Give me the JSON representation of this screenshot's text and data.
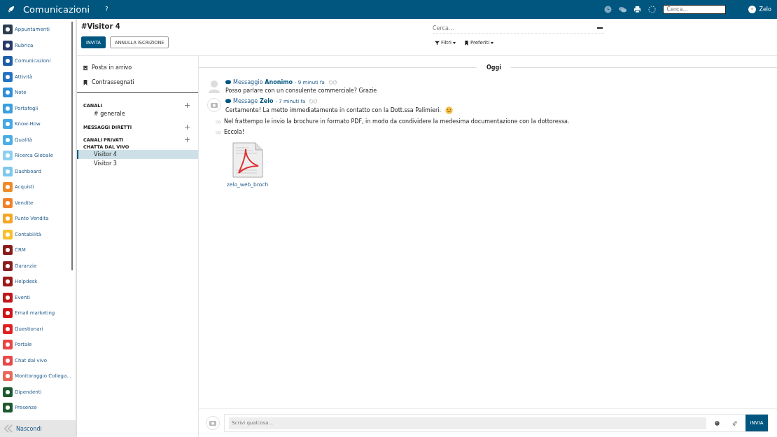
{
  "topbar": {
    "title": "Comunicazioni",
    "help": "?",
    "search": {
      "placeholder": "Cerca..."
    },
    "user": "Zelo"
  },
  "sidebar": {
    "items": [
      {
        "label": "Appuntamenti",
        "color": "#2c3e50"
      },
      {
        "label": "Rubrica",
        "color": "#2a3a6a"
      },
      {
        "label": "Comunicazioni",
        "color": "#1f5fa8"
      },
      {
        "label": "Attività",
        "color": "#2473c4"
      },
      {
        "label": "Note",
        "color": "#2f8fd8"
      },
      {
        "label": "Portafogli",
        "color": "#3ba0e0"
      },
      {
        "label": "Know-How",
        "color": "#45a8e4"
      },
      {
        "label": "Qualità",
        "color": "#4aaee6"
      },
      {
        "label": "Ricerca Globale",
        "color": "#8fd0f0"
      },
      {
        "label": "Dashboard",
        "color": "#7ec8ee"
      },
      {
        "label": "Acquisti",
        "color": "#f08a2a"
      },
      {
        "label": "Vendite",
        "color": "#f0832a"
      },
      {
        "label": "Punto Vendita",
        "color": "#f5a623"
      },
      {
        "label": "Contabilità",
        "color": "#f8c030"
      },
      {
        "label": "CRM",
        "color": "#8b1a1a"
      },
      {
        "label": "Garanzie",
        "color": "#8b1f1f"
      },
      {
        "label": "Helpdesk",
        "color": "#9b1b1b"
      },
      {
        "label": "Eventi",
        "color": "#c0181b"
      },
      {
        "label": "Email marketing",
        "color": "#d0151a"
      },
      {
        "label": "Questionari",
        "color": "#e02020"
      },
      {
        "label": "Portale",
        "color": "#e84545"
      },
      {
        "label": "Chat dal vivo",
        "color": "#e84848"
      },
      {
        "label": "Monitoraggio Collega...",
        "color": "#e86a5a"
      },
      {
        "label": "Dipendenti",
        "color": "#1e5a2e"
      },
      {
        "label": "Presenze",
        "color": "#1e5a30"
      }
    ],
    "hide": "Nascondi"
  },
  "header": {
    "title": "#Visitor 4",
    "buttons": [
      {
        "label": "INVITA",
        "kind": "primary"
      },
      {
        "label": "ANNULLA ISCRIZIONE",
        "kind": "secondary"
      }
    ],
    "search": {
      "placeholder": "Cerca..."
    },
    "filters": [
      {
        "label": "Filtri",
        "kind": "filter"
      },
      {
        "label": "Preferiti",
        "kind": "bookmark"
      }
    ]
  },
  "mailboxes": [
    {
      "label": "Posta in arrivo",
      "kind": "inbox"
    },
    {
      "label": "Contrassegnati",
      "kind": "bookmark"
    }
  ],
  "channel_groups": [
    {
      "title": "CANALI",
      "addable": true,
      "items": [
        {
          "label": "# generale",
          "selected": false
        }
      ]
    },
    {
      "title": "MESSAGGI DIRETTI",
      "addable": true
    },
    {
      "title": "CANALI PRIVATI",
      "addable": true
    },
    {
      "title": "CHATTA DAL VIVO",
      "addable": false,
      "items": [
        {
          "label": "Visitor 4",
          "selected": true
        },
        {
          "label": "Visitor 3",
          "selected": false
        }
      ]
    }
  ],
  "chat": {
    "date": "Oggi",
    "messages": [
      {
        "kind": "visitor",
        "type": "Messaggio",
        "author": "Anonimo",
        "time": "- 9 minuti fa",
        "text": "Posso parlare con un consulente commerciale? Grazie",
        "emoji": false
      },
      {
        "kind": "agent",
        "type": "Message",
        "author": "Zelo",
        "time": "- 7 minuti fa",
        "text": "Certamente! La metto immediatamente in contatto con la Dott.ssa Palimieri.",
        "emoji": true,
        "followups": [
          {
            "kind": "text",
            "text": "Nel frattempo le invio la brochure in formato PDF, in modo da condividere la medesima documentazione con la dottoressa."
          },
          {
            "kind": "text",
            "text": "Eccola!"
          },
          {
            "kind": "attachment",
            "text": "zelo_web_broch"
          }
        ]
      }
    ],
    "composer": {
      "placeholder": "Scrivi qualcosa...",
      "send": "INVIA"
    }
  }
}
